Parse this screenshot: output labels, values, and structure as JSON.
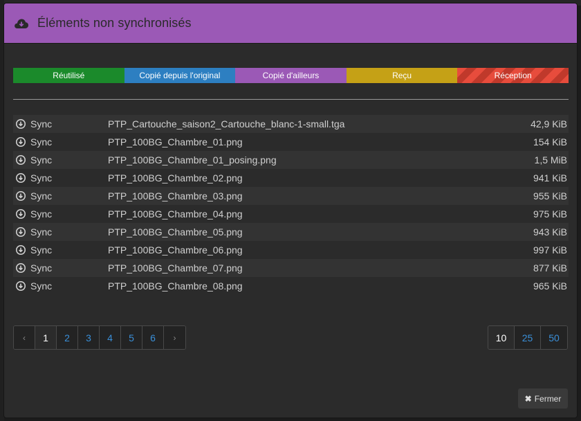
{
  "header": {
    "title": "Éléments non synchronisés",
    "icon": "cloud-download-icon",
    "color": "#9b59b6"
  },
  "legend": [
    {
      "label": "Réutilisé",
      "color": "#1b8a2b"
    },
    {
      "label": "Copié depuis l'original",
      "color": "#2d7fc1"
    },
    {
      "label": "Copié d'ailleurs",
      "color": "#9b59b6"
    },
    {
      "label": "Reçu",
      "color": "#c5a116"
    },
    {
      "label": "Réception",
      "color": "#e74c3c"
    }
  ],
  "items": [
    {
      "status": "Sync",
      "name": "PTP_Cartouche_saison2_Cartouche_blanc-1-small.tga",
      "size": "42,9 KiB"
    },
    {
      "status": "Sync",
      "name": "PTP_100BG_Chambre_01.png",
      "size": "154 KiB"
    },
    {
      "status": "Sync",
      "name": "PTP_100BG_Chambre_01_posing.png",
      "size": "1,5 MiB"
    },
    {
      "status": "Sync",
      "name": "PTP_100BG_Chambre_02.png",
      "size": "941 KiB"
    },
    {
      "status": "Sync",
      "name": "PTP_100BG_Chambre_03.png",
      "size": "955 KiB"
    },
    {
      "status": "Sync",
      "name": "PTP_100BG_Chambre_04.png",
      "size": "975 KiB"
    },
    {
      "status": "Sync",
      "name": "PTP_100BG_Chambre_05.png",
      "size": "943 KiB"
    },
    {
      "status": "Sync",
      "name": "PTP_100BG_Chambre_06.png",
      "size": "997 KiB"
    },
    {
      "status": "Sync",
      "name": "PTP_100BG_Chambre_07.png",
      "size": "877 KiB"
    },
    {
      "status": "Sync",
      "name": "PTP_100BG_Chambre_08.png",
      "size": "965 KiB"
    }
  ],
  "pagination": {
    "prev": "‹",
    "next": "›",
    "pages": [
      "1",
      "2",
      "3",
      "4",
      "5",
      "6"
    ],
    "current": "1"
  },
  "page_size": {
    "options": [
      "10",
      "25",
      "50"
    ],
    "selected": "10"
  },
  "footer": {
    "close_label": "Fermer"
  }
}
